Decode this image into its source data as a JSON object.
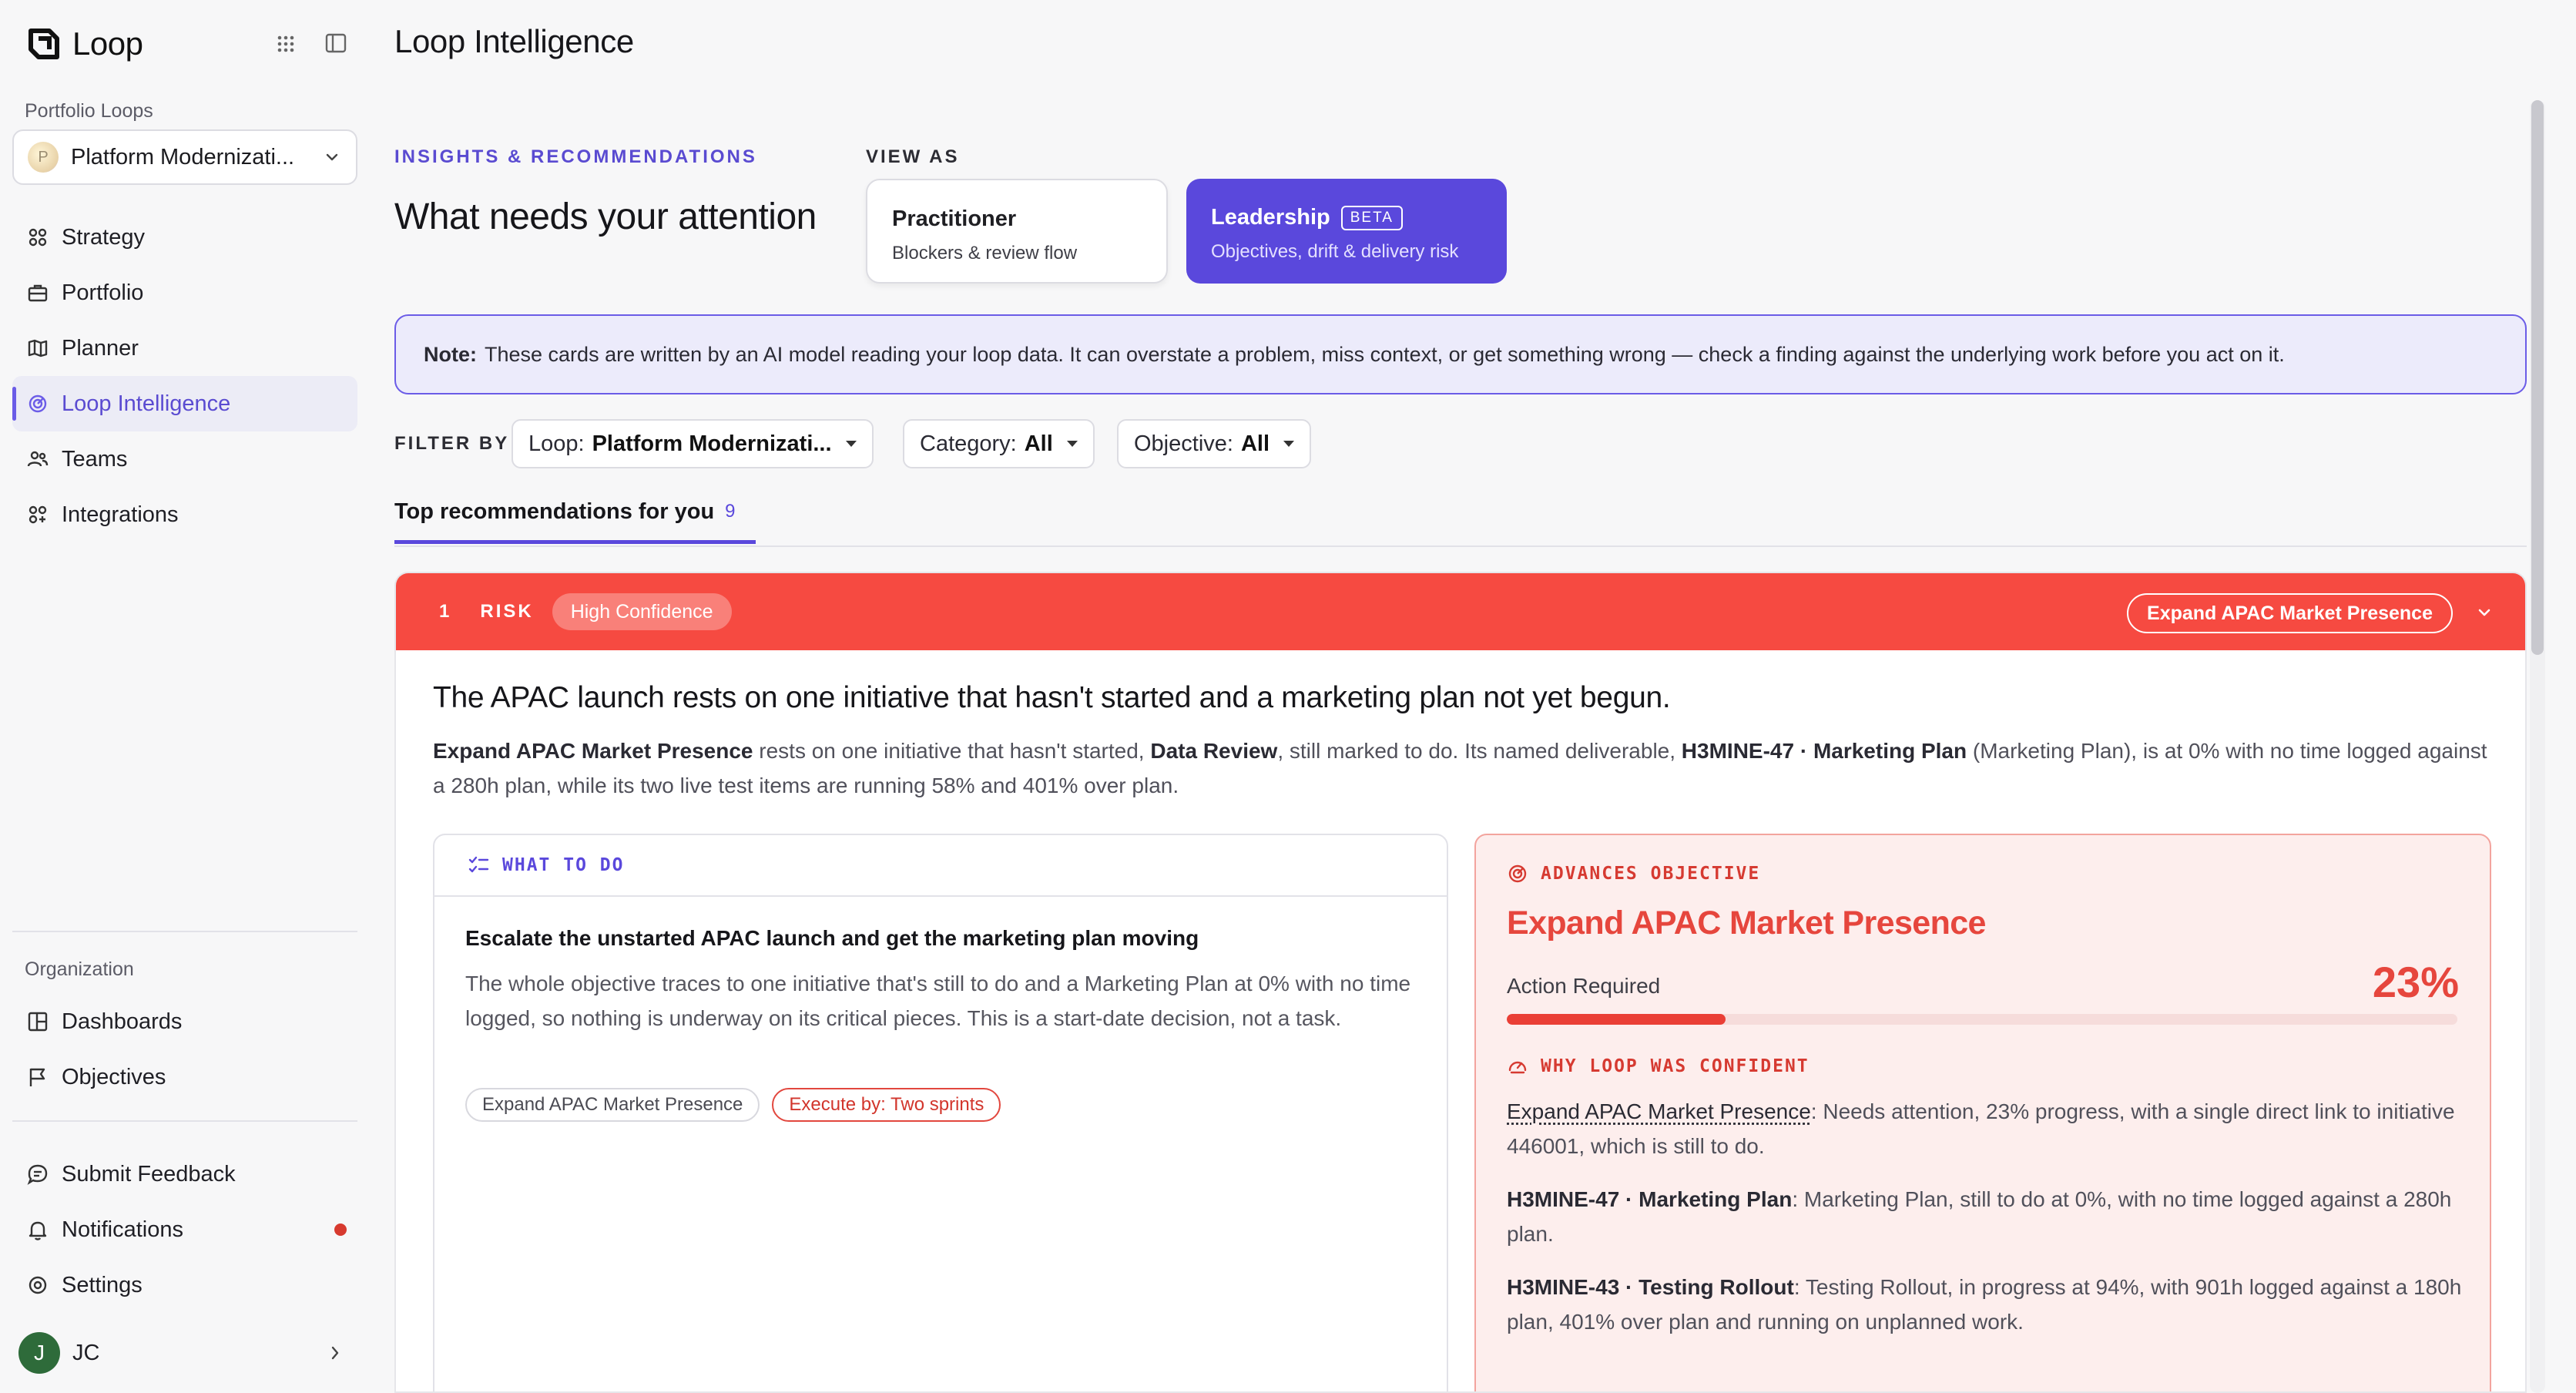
{
  "app": {
    "name": "Loop"
  },
  "sidebar": {
    "portfolio_label": "Portfolio Loops",
    "loop_selector": {
      "avatar_letter": "P",
      "value": "Platform Modernizati..."
    },
    "nav": [
      {
        "label": "Strategy",
        "icon": "strategy-icon"
      },
      {
        "label": "Portfolio",
        "icon": "briefcase-icon"
      },
      {
        "label": "Planner",
        "icon": "map-icon"
      },
      {
        "label": "Loop Intelligence",
        "icon": "radar-icon",
        "active": true
      },
      {
        "label": "Teams",
        "icon": "users-icon"
      },
      {
        "label": "Integrations",
        "icon": "integrations-icon"
      }
    ],
    "org_label": "Organization",
    "org_nav": [
      {
        "label": "Dashboards",
        "icon": "dashboard-icon"
      },
      {
        "label": "Objectives",
        "icon": "flag-icon"
      }
    ],
    "footer_nav": [
      {
        "label": "Submit Feedback",
        "icon": "feedback-icon"
      },
      {
        "label": "Notifications",
        "icon": "bell-icon"
      },
      {
        "label": "Settings",
        "icon": "gear-icon"
      }
    ],
    "user": {
      "initial": "J",
      "name": "JC"
    }
  },
  "header": {
    "title": "Loop Intelligence"
  },
  "insights": {
    "eyebrow": "INSIGHTS & RECOMMENDATIONS",
    "headline": "What needs your attention"
  },
  "view_as": {
    "label": "VIEW AS",
    "options": [
      {
        "title": "Practitioner",
        "subtitle": "Blockers & review flow"
      },
      {
        "title": "Leadership",
        "badge": "BETA",
        "subtitle": "Objectives, drift & delivery risk",
        "selected": true
      }
    ]
  },
  "note": {
    "prefix": "Note:",
    "text": "These cards are written by an AI model reading your loop data. It can overstate a problem, miss context, or get something wrong — check a finding against the underlying work before you act on it."
  },
  "filters": {
    "label": "FILTER BY",
    "items": [
      {
        "name": "Loop:",
        "value": "Platform Modernizati..."
      },
      {
        "name": "Category:",
        "value": "All"
      },
      {
        "name": "Objective:",
        "value": "All"
      }
    ]
  },
  "tabs": [
    {
      "label": "Top recommendations for you",
      "count": "9"
    }
  ],
  "recommendation": {
    "number": "1",
    "category": "RISK",
    "confidence": "High Confidence",
    "objective_pill": "Expand APAC Market Presence",
    "title": "The APAC launch rests on one initiative that hasn't started and a marketing plan not yet begun.",
    "summary": {
      "obj": "Expand APAC Market Presence",
      "t1": " rests on one initiative that hasn't started, ",
      "init": "Data Review",
      "t2": ", still marked to do. Its named deliverable, ",
      "deliv": "H3MINE-47 · Marketing Plan",
      "t3": " (Marketing Plan), is at 0% with no time logged against a 280h plan, while its two live test items are running 58% and 401% over plan."
    },
    "what_to_do": {
      "label": "WHAT TO DO",
      "title": "Escalate the unstarted APAC launch and get the marketing plan moving",
      "body": "The whole objective traces to one initiative that's still to do and a Marketing Plan at 0% with no time logged, so nothing is underway on its critical pieces. This is a start-date decision, not a task.",
      "tags": [
        "Expand APAC Market Presence",
        "Execute by: Two sprints"
      ]
    },
    "advances": {
      "label": "ADVANCES OBJECTIVE",
      "objective": "Expand APAC Market Presence",
      "status": "Action Required",
      "progress_label": "23%",
      "progress": 0.23
    },
    "why": {
      "label": "WHY LOOP WAS CONFIDENT",
      "items": [
        {
          "key": "Expand APAC Market Presence",
          "text": ": Needs attention, 23% progress, with a single direct link to initiative 446001, which is still to do."
        },
        {
          "key": "H3MINE-47 · Marketing Plan",
          "text": ": Marketing Plan, still to do at 0%, with no time logged against a 280h plan."
        },
        {
          "key": "H3MINE-43 · Testing Rollout",
          "text": ": Testing Rollout, in progress at 94%, with 901h logged against a 180h plan, 401% over plan and running on unplanned work."
        }
      ]
    }
  },
  "colors": {
    "accent": "#5a48dc",
    "risk": "#f64a41"
  }
}
